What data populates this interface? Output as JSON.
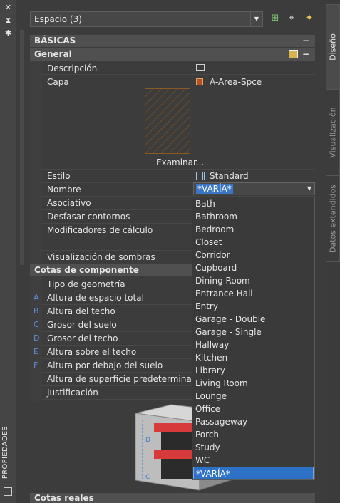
{
  "palette": {
    "title": "PROPIEDADES",
    "close_icon": "✕",
    "autohide_icon": "⧗",
    "settings_icon": "✱"
  },
  "object_select": {
    "value": "Espacio (3)"
  },
  "sections": {
    "basicas": {
      "title": "BÁSICAS"
    },
    "general": {
      "title": "General"
    },
    "cotas": {
      "title": "Cotas de componente"
    },
    "bottom": {
      "title": "Cotas reales"
    }
  },
  "general_rows": {
    "descripcion": {
      "label": "Descripción"
    },
    "capa": {
      "label": "Capa",
      "value": "A-Area-Spce",
      "swatch": "#b5531e"
    },
    "browse": {
      "label": "Examinar..."
    },
    "estilo": {
      "label": "Estilo",
      "value": "Standard"
    },
    "nombre": {
      "label": "Nombre",
      "value": "*VARÍA*"
    },
    "asociativo": {
      "label": "Asociativo"
    },
    "desfasar": {
      "label": "Desfasar contornos"
    },
    "modificadores": {
      "label": "Modificadores de cálculo"
    },
    "sombras": {
      "label": "Visualización de sombras"
    }
  },
  "cotas_rows": [
    {
      "letter": "",
      "label": "Tipo de geometría"
    },
    {
      "letter": "A",
      "label": "Altura de espacio total"
    },
    {
      "letter": "B",
      "label": "Altura del techo"
    },
    {
      "letter": "C",
      "label": "Grosor del suelo"
    },
    {
      "letter": "D",
      "label": "Grosor del techo"
    },
    {
      "letter": "E",
      "label": "Altura sobre el techo"
    },
    {
      "letter": "F",
      "label": "Altura por debajo del suelo"
    },
    {
      "letter": "",
      "label": "Altura de superficie predeterminada"
    },
    {
      "letter": "",
      "label": "Justificación"
    }
  ],
  "name_options": [
    "Bath",
    "Bathroom",
    "Bedroom",
    "Closet",
    "Corridor",
    "Cupboard",
    "Dining Room",
    "Entrance Hall",
    "Entry",
    "Garage - Double",
    "Garage - Single",
    "Hallway",
    "Kitchen",
    "Library",
    "Living Room",
    "Lounge",
    "Office",
    "Passageway",
    "Porch",
    "Study",
    "WC",
    "*VARÍA*"
  ],
  "selected_option": "*VARÍA*",
  "tabs": {
    "diseno": "Diseño",
    "visualizacion": "Visualización",
    "datos": "Datos extendidos"
  },
  "colors": {
    "accent": "#2d72c6",
    "layer_swatch": "#b5531e",
    "dimension_letters": "#5c8fd6"
  }
}
